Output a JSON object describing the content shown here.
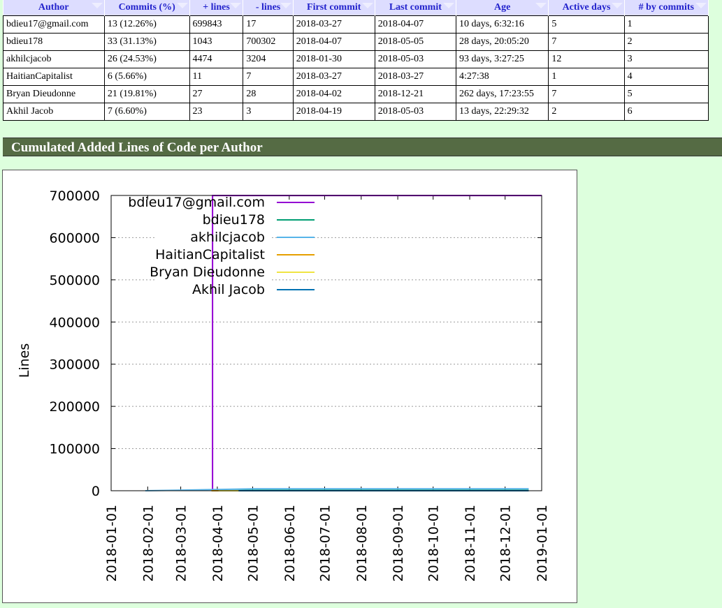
{
  "table": {
    "headers": [
      "Author",
      "Commits (%)",
      "+ lines",
      "- lines",
      "First commit",
      "Last commit",
      "Age",
      "Active days",
      "# by commits"
    ],
    "rows": [
      [
        "bdieu17@gmail.com",
        "13 (12.26%)",
        "699843",
        "17",
        "2018-03-27",
        "2018-04-07",
        "10 days, 6:32:16",
        "5",
        "1"
      ],
      [
        "bdieu178",
        "33 (31.13%)",
        "1043",
        "700302",
        "2018-04-07",
        "2018-05-05",
        "28 days, 20:05:20",
        "7",
        "2"
      ],
      [
        "akhilcjacob",
        "26 (24.53%)",
        "4474",
        "3204",
        "2018-01-30",
        "2018-05-03",
        "93 days, 3:27:25",
        "12",
        "3"
      ],
      [
        "HaitianCapitalist",
        "6 (5.66%)",
        "11",
        "7",
        "2018-03-27",
        "2018-03-27",
        "4:27:38",
        "1",
        "4"
      ],
      [
        "Bryan Dieudonne",
        "21 (19.81%)",
        "27",
        "28",
        "2018-04-02",
        "2018-12-21",
        "262 days, 17:23:55",
        "7",
        "5"
      ],
      [
        "Akhil Jacob",
        "7 (6.60%)",
        "23",
        "3",
        "2018-04-19",
        "2018-05-03",
        "13 days, 22:29:32",
        "2",
        "6"
      ]
    ]
  },
  "section_title": "Cumulated Added Lines of Code per Author",
  "chart_data": {
    "type": "line",
    "ylabel": "Lines",
    "xlabel": "",
    "ylim": [
      0,
      700000
    ],
    "yticks": [
      "0",
      "100000",
      "200000",
      "300000",
      "400000",
      "500000",
      "600000",
      "700000"
    ],
    "xticks": [
      "2018-01-01",
      "2018-02-01",
      "2018-03-01",
      "2018-04-01",
      "2018-05-01",
      "2018-06-01",
      "2018-07-01",
      "2018-08-01",
      "2018-09-01",
      "2018-10-01",
      "2018-11-01",
      "2018-12-01",
      "2019-01-01"
    ],
    "grid": true,
    "legend_position": "top-left",
    "series": [
      {
        "name": "bdieu17@gmail.com",
        "color": "#9400d3",
        "x": [
          "2018-03-27",
          "2018-03-28",
          "2018-03-28",
          "2018-04-07",
          "2019-01-01"
        ],
        "y": [
          0,
          0,
          699843,
          699843,
          699843
        ]
      },
      {
        "name": "bdieu178",
        "color": "#009e73",
        "x": [
          "2018-04-07",
          "2018-05-05",
          "2018-12-21"
        ],
        "y": [
          0,
          1043,
          1043
        ]
      },
      {
        "name": "akhilcjacob",
        "color": "#56b4e9",
        "x": [
          "2018-01-30",
          "2018-03-15",
          "2018-05-03",
          "2018-12-21"
        ],
        "y": [
          0,
          2000,
          4474,
          4474
        ]
      },
      {
        "name": "HaitianCapitalist",
        "color": "#e69f00",
        "x": [
          "2018-03-27",
          "2018-12-21"
        ],
        "y": [
          11,
          11
        ]
      },
      {
        "name": "Bryan Dieudonne",
        "color": "#f0e442",
        "x": [
          "2018-04-02",
          "2018-12-21"
        ],
        "y": [
          27,
          27
        ]
      },
      {
        "name": "Akhil Jacob",
        "color": "#0072b2",
        "x": [
          "2018-04-19",
          "2018-05-03",
          "2018-12-21"
        ],
        "y": [
          0,
          23,
          23
        ]
      }
    ]
  }
}
